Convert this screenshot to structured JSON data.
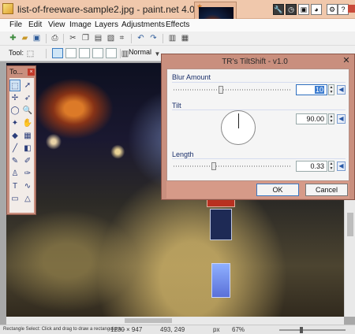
{
  "window": {
    "title": "list-of-freeware-sample2.jpg - paint.net 4.0.6",
    "thumbnail_star": "★"
  },
  "menu": {
    "items": [
      "File",
      "Edit",
      "View",
      "Image",
      "Layers",
      "Adjustments",
      "Effects"
    ]
  },
  "toolbar": {
    "tool_label": "Tool:",
    "blend_mode": "Normal"
  },
  "tools_panel": {
    "title": "To...",
    "close": "×",
    "tools": [
      {
        "icon": "rectangle-select-icon",
        "glyph": "⬚"
      },
      {
        "icon": "move-selection-icon",
        "glyph": "➚"
      },
      {
        "icon": "lasso-select-icon",
        "glyph": "✢"
      },
      {
        "icon": "move-selected-icon",
        "glyph": "➶"
      },
      {
        "icon": "ellipse-select-icon",
        "glyph": "◯"
      },
      {
        "icon": "zoom-icon",
        "glyph": "🔍"
      },
      {
        "icon": "magic-wand-icon",
        "glyph": "✦"
      },
      {
        "icon": "pan-icon",
        "glyph": "✋"
      },
      {
        "icon": "paint-bucket-icon",
        "glyph": "◆"
      },
      {
        "icon": "gradient-icon",
        "glyph": "▦"
      },
      {
        "icon": "paintbrush-icon",
        "glyph": "╱"
      },
      {
        "icon": "eraser-icon",
        "glyph": "◧"
      },
      {
        "icon": "pencil-icon",
        "glyph": "✎"
      },
      {
        "icon": "color-picker-icon",
        "glyph": "✐"
      },
      {
        "icon": "clone-stamp-icon",
        "glyph": "♙"
      },
      {
        "icon": "recolor-icon",
        "glyph": "✑"
      },
      {
        "icon": "text-icon",
        "glyph": "T"
      },
      {
        "icon": "line-curve-icon",
        "glyph": "∿"
      },
      {
        "icon": "shapes-icon",
        "glyph": "▭"
      },
      {
        "icon": "shapes-triangle-icon",
        "glyph": "△"
      }
    ]
  },
  "dialog": {
    "title": "TR's TiltShift - v1.0",
    "close": "✕",
    "blur_label": "Blur Amount",
    "blur_value": "10",
    "blur_level": 0.12,
    "tilt_label": "Tilt",
    "tilt_value": "90.00",
    "length_label": "Length",
    "length_value": "0.33",
    "length_level": 0.33,
    "ok_label": "OK",
    "cancel_label": "Cancel",
    "spin_up": "▲",
    "spin_down": "▼",
    "reset_glyph": "◀"
  },
  "status": {
    "hint": "Rectangle Select: Click and drag to draw a rectangular s...",
    "image_size": "1280 × 947",
    "cursor": "493, 249",
    "units": "px",
    "zoom": "67%"
  }
}
